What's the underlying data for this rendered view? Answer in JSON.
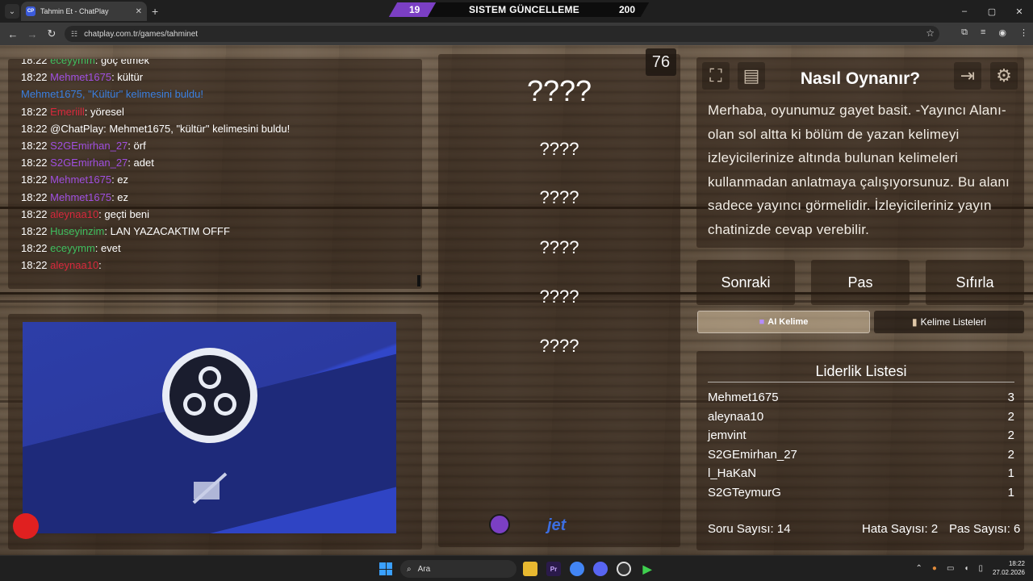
{
  "browser": {
    "tab_title": "Tahmin Et - ChatPlay",
    "favicon_text": "CP",
    "url": "chatplay.com.tr/games/tahminet",
    "window_controls": [
      "–",
      "▢",
      "✕"
    ]
  },
  "banner": {
    "left_value": "19",
    "title": "SISTEM GÜNCELLEME",
    "right_value": "200"
  },
  "chat": {
    "messages": [
      {
        "time": "18:22",
        "user": "eceyymm",
        "user_color": "#3fbf5f",
        "text": ": göç etmek",
        "system": false
      },
      {
        "time": "18:22",
        "user": "Mehmet1675",
        "user_color": "#a04fe0",
        "text": ": kültür",
        "system": false
      },
      {
        "time": "",
        "user": "",
        "user_color": "#3a7fe0",
        "text": "Mehmet1675, \"Kültür\" kelimesini buldu!",
        "system": true
      },
      {
        "time": "18:22",
        "user": "Emeriill",
        "user_color": "#d8283c",
        "text": ": yöresel",
        "system": false
      },
      {
        "time": "18:22",
        "user": "",
        "user_color": "#ffffff",
        "text": "@ChatPlay: Mehmet1675, \"kültür\" kelimesini buldu!",
        "system": false
      },
      {
        "time": "18:22",
        "user": "S2GEmirhan_27",
        "user_color": "#a04fe0",
        "text": ": örf",
        "system": false
      },
      {
        "time": "18:22",
        "user": "S2GEmirhan_27",
        "user_color": "#a04fe0",
        "text": ": adet",
        "system": false
      },
      {
        "time": "18:22",
        "user": "Mehmet1675",
        "user_color": "#a04fe0",
        "text": ": ez",
        "system": false
      },
      {
        "time": "18:22",
        "user": "Mehmet1675",
        "user_color": "#a04fe0",
        "text": ": ez",
        "system": false
      },
      {
        "time": "18:22",
        "user": "aleynaa10",
        "user_color": "#d8283c",
        "text": ": geçti beni",
        "system": false
      },
      {
        "time": "18:22",
        "user": "Huseyinzim",
        "user_color": "#3fbf5f",
        "text": ": LAN YAZACAKTIM OFFF",
        "system": false
      },
      {
        "time": "18:22",
        "user": "eceyymm",
        "user_color": "#3fbf5f",
        "text": ": evet",
        "system": false
      },
      {
        "time": "18:22",
        "user": "aleynaa10",
        "user_color": "#d8283c",
        "text": ":",
        "system": false
      }
    ]
  },
  "game": {
    "timer": "76",
    "main_word": "????",
    "hidden_words": [
      "????",
      "????",
      "????",
      "????",
      "????"
    ],
    "sponsor": "jet"
  },
  "howto": {
    "title": "Nasıl Oynanır?",
    "text": "Merhaba, oyunumuz gayet basit. -Yayıncı Alanı- olan sol altta ki bölüm de yazan kelimeyi izleyicilerinize altında bulunan kelimeleri kullanmadan anlatmaya çalışıyorsunuz. Bu alanı sadece yayıncı görmelidir. İzleyicileriniz yayın chatinizde cevap verebilir."
  },
  "actions": {
    "next": "Sonraki",
    "pass": "Pas",
    "reset": "Sıfırla"
  },
  "tabs": {
    "ai_word": "AI Kelime",
    "word_lists": "Kelime Listeleri"
  },
  "leaderboard": {
    "title": "Liderlik Listesi",
    "rows": [
      {
        "name": "Mehmet1675",
        "score": "3"
      },
      {
        "name": "aleynaa10",
        "score": "2"
      },
      {
        "name": "jemvint",
        "score": "2"
      },
      {
        "name": "S2GEmirhan_27",
        "score": "2"
      },
      {
        "name": "l_HaKaN",
        "score": "1"
      },
      {
        "name": "S2GTeymurG",
        "score": "1"
      }
    ],
    "question_count": "Soru Sayısı: 14",
    "error_count": "Hata Sayısı: 2",
    "pass_count": "Pas Sayısı: 6"
  },
  "taskbar": {
    "search_placeholder": "Ara",
    "time": "18:22",
    "date": "27.02.2026"
  }
}
